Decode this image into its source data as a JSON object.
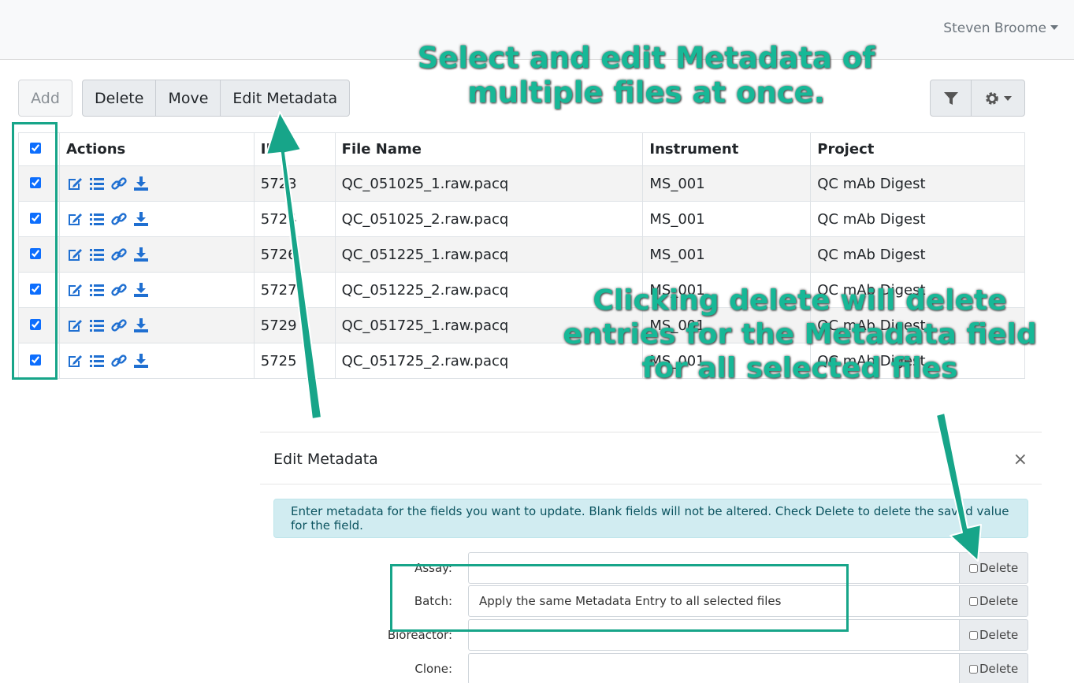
{
  "header": {
    "user": "Steven Broome"
  },
  "toolbar": {
    "add": "Add",
    "delete": "Delete",
    "move": "Move",
    "edit_metadata": "Edit Metadata"
  },
  "table": {
    "headers": {
      "actions": "Actions",
      "id": "ID",
      "file_name": "File Name",
      "instrument": "Instrument",
      "project": "Project"
    },
    "rows": [
      {
        "id": "5723",
        "file_name": "QC_051025_1.raw.pacq",
        "instrument": "MS_001",
        "project": "QC mAb Digest"
      },
      {
        "id": "5724",
        "file_name": "QC_051025_2.raw.pacq",
        "instrument": "MS_001",
        "project": "QC mAb Digest"
      },
      {
        "id": "5726",
        "file_name": "QC_051225_1.raw.pacq",
        "instrument": "MS_001",
        "project": "QC mAb Digest"
      },
      {
        "id": "5727",
        "file_name": "QC_051225_2.raw.pacq",
        "instrument": "MS_001",
        "project": "QC mAb Digest"
      },
      {
        "id": "5729",
        "file_name": "QC_051725_1.raw.pacq",
        "instrument": "MS_001",
        "project": "QC mAb Digest"
      },
      {
        "id": "5725",
        "file_name": "QC_051725_2.raw.pacq",
        "instrument": "MS_001",
        "project": "QC mAb Digest"
      }
    ]
  },
  "modal": {
    "title": "Edit Metadata",
    "close": "×",
    "info": "Enter metadata for the fields you want to update. Blank fields will not be altered. Check Delete to delete the saved value for the field.",
    "delete_label": "Delete",
    "fields": [
      {
        "label": "Assay:",
        "value": ""
      },
      {
        "label": "Batch:",
        "value": "Apply the same Metadata Entry to all selected files"
      },
      {
        "label": "Bioreactor:",
        "value": ""
      },
      {
        "label": "Clone:",
        "value": ""
      }
    ]
  },
  "annotations": {
    "top": "Select and edit Metadata of multiple files at once.",
    "right": "Clicking delete will delete entries for the Metadata field for all selected files",
    "color": "#17b897"
  }
}
